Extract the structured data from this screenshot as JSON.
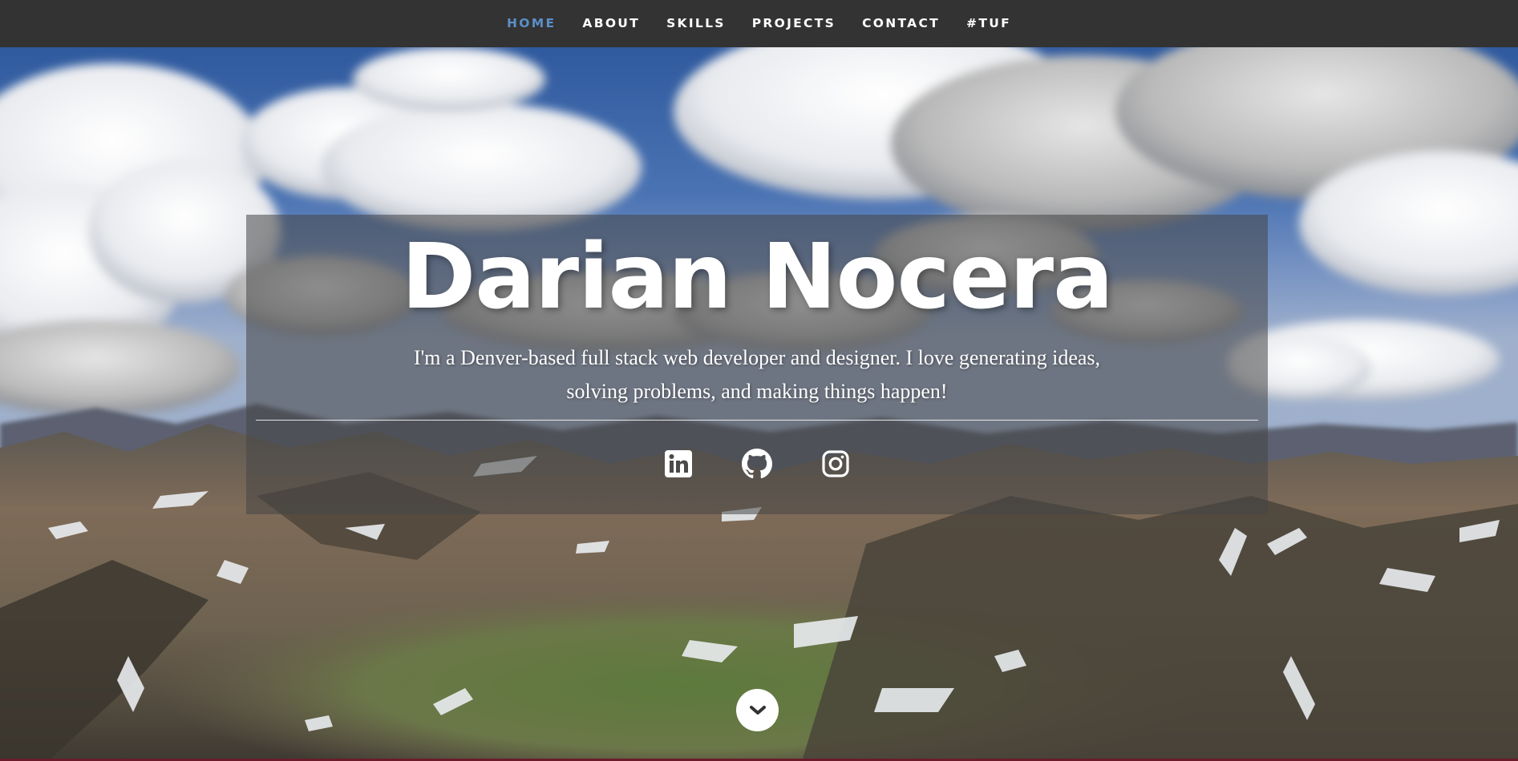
{
  "nav": {
    "items": [
      {
        "label": "HOME",
        "active": true
      },
      {
        "label": "ABOUT",
        "active": false
      },
      {
        "label": "SKILLS",
        "active": false
      },
      {
        "label": "PROJECTS",
        "active": false
      },
      {
        "label": "CONTACT",
        "active": false
      },
      {
        "label": "#TUF",
        "active": false
      }
    ]
  },
  "hero": {
    "title": "Darian Nocera",
    "subtitle": "I'm a Denver-based full stack web developer and designer. I love generating ideas, solving problems, and making things happen!",
    "social": [
      {
        "icon": "linkedin-icon"
      },
      {
        "icon": "github-icon"
      },
      {
        "icon": "instagram-icon"
      }
    ],
    "scroll_icon": "chevron-down-icon"
  },
  "colors": {
    "nav_bg": "#333333",
    "nav_active": "#5b8fc7",
    "nav_text": "#ffffff",
    "box_overlay": "rgba(70,70,70,0.55)",
    "accent_strip": "#6b1c2a"
  }
}
